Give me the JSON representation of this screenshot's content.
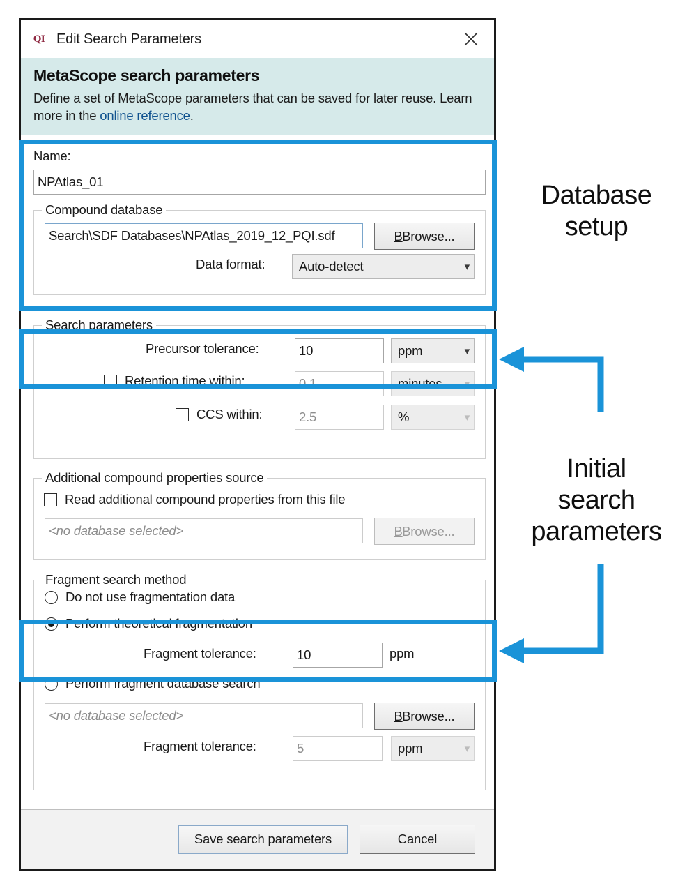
{
  "window": {
    "title": "Edit Search Parameters",
    "app_icon_label": "QI",
    "close_icon": "close-icon"
  },
  "banner": {
    "title": "MetaScope search parameters",
    "desc_before": "Define a set of MetaScope parameters that can be saved for later reuse. Learn more in the ",
    "link": "online reference",
    "desc_after": "."
  },
  "name_section": {
    "label": "Name:",
    "value": "NPAtlas_01"
  },
  "compound_database": {
    "group_title": "Compound database",
    "path_value": "Search\\SDF Databases\\NPAtlas_2019_12_PQI.sdf",
    "browse_label": "Browse...",
    "browse_mnemonic": "B",
    "data_format_label": "Data format:",
    "data_format_value": "Auto-detect"
  },
  "search_parameters": {
    "group_title": "Search parameters",
    "precursor_label": "Precursor tolerance:",
    "precursor_value": "10",
    "precursor_unit": "ppm",
    "retention_label": "Retention time within:",
    "retention_value": "0.1",
    "retention_unit": "minutes",
    "retention_checked": false,
    "ccs_label": "CCS within:",
    "ccs_value": "2.5",
    "ccs_unit": "%",
    "ccs_checked": false
  },
  "additional_properties": {
    "group_title": "Additional compound properties source",
    "checkbox_label": "Read additional compound properties from this file",
    "checkbox_checked": false,
    "file_placeholder": "<no database selected>",
    "browse_label": "Browse...",
    "browse_mnemonic": "B"
  },
  "fragment_method": {
    "group_title": "Fragment search method",
    "option_none": "Do not use fragmentation data",
    "option_theoretical": "Perform theoretical fragmentation",
    "option_database": "Perform fragment database search",
    "selected": "theoretical",
    "theoretical_tolerance_label": "Fragment tolerance:",
    "theoretical_tolerance_value": "10",
    "theoretical_tolerance_unit": "ppm",
    "database_file_placeholder": "<no database selected>",
    "database_browse_label": "Browse...",
    "database_browse_mnemonic": "B",
    "database_tolerance_label": "Fragment tolerance:",
    "database_tolerance_value": "5",
    "database_tolerance_unit": "ppm"
  },
  "footer": {
    "save_label": "Save search parameters",
    "cancel_label": "Cancel"
  },
  "annotations": {
    "database_setup": "Database\nsetup",
    "initial_search": "Initial\nsearch\nparameters",
    "highlight_color": "#1a93d8"
  }
}
